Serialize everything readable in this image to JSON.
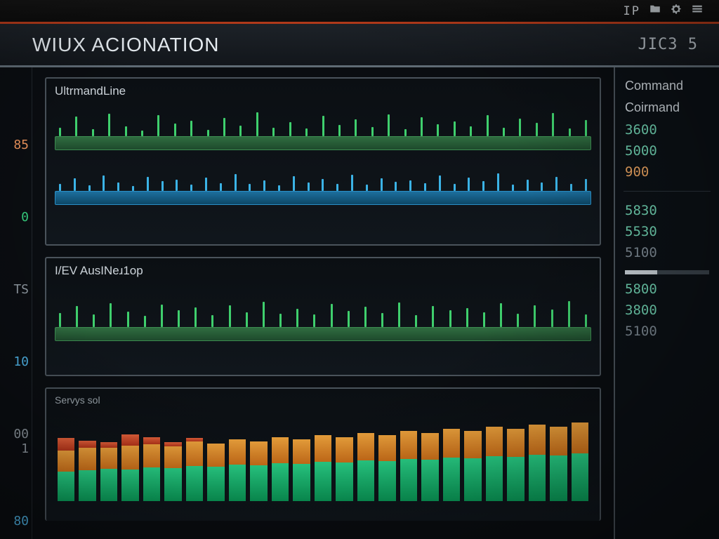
{
  "system": {
    "code": "IP",
    "icons": [
      "folder-icon",
      "gear-icon",
      "menu-icon"
    ]
  },
  "window": {
    "title_a": "WIUX",
    "title_b": "ACIONATION",
    "session": "JIC3 5"
  },
  "gutter": {
    "ticks": [
      "85",
      "0",
      "TS",
      "10",
      "00 1",
      "80"
    ]
  },
  "panels": {
    "p1": {
      "title": "UltrmandLine"
    },
    "p2": {
      "title": "I/EV AusINeɹ1op"
    },
    "p3": {
      "sub": "Servys sol"
    }
  },
  "sidebar": {
    "header1": "Command",
    "header2": "Coirmand",
    "values": [
      "3600",
      "5000",
      "900",
      "5830",
      "5530",
      "5100"
    ],
    "lower": [
      "5800",
      "3800",
      "5100"
    ]
  },
  "chart_data": [
    {
      "type": "bar",
      "title": "UltrmandLine",
      "series": [
        {
          "name": "green-ticks",
          "values": [
            12,
            28,
            10,
            32,
            14,
            8,
            30,
            18,
            22,
            9,
            26,
            15,
            34,
            12,
            20,
            11,
            29,
            16,
            24,
            13,
            31,
            10,
            27,
            17,
            21,
            14,
            30,
            12,
            25,
            19,
            33,
            11,
            23
          ]
        },
        {
          "name": "blue-ticks",
          "values": [
            10,
            18,
            8,
            22,
            12,
            7,
            20,
            14,
            16,
            9,
            19,
            11,
            24,
            10,
            15,
            8,
            21,
            12,
            17,
            10,
            23,
            9,
            18,
            13,
            15,
            11,
            22,
            10,
            19,
            14,
            25,
            9,
            16,
            12,
            20,
            10,
            17
          ]
        }
      ],
      "ylim": [
        0,
        40
      ]
    },
    {
      "type": "bar",
      "title": "I/EV AusINeɹ1op",
      "series": [
        {
          "name": "green-ticks",
          "values": [
            20,
            30,
            18,
            34,
            22,
            16,
            32,
            24,
            28,
            17,
            31,
            21,
            36,
            19,
            26,
            18,
            33,
            23,
            29,
            20,
            35,
            17,
            30,
            24,
            27,
            21,
            34,
            19,
            31,
            25,
            37,
            18
          ]
        }
      ],
      "ylim": [
        0,
        40
      ]
    },
    {
      "type": "bar",
      "title": "Servys sol",
      "xlabel": "",
      "ylabel": "",
      "series": [
        {
          "name": "green",
          "values": [
            42,
            44,
            46,
            45,
            48,
            47,
            50,
            49,
            52,
            51,
            54,
            53,
            56,
            55,
            58,
            57,
            60,
            59,
            62,
            61,
            64,
            63,
            66,
            65,
            68
          ]
        },
        {
          "name": "orange",
          "values": [
            30,
            32,
            30,
            34,
            33,
            31,
            35,
            33,
            36,
            34,
            37,
            35,
            38,
            36,
            39,
            37,
            40,
            38,
            41,
            39,
            42,
            40,
            43,
            41,
            44
          ]
        },
        {
          "name": "red",
          "values": [
            18,
            10,
            8,
            16,
            10,
            6,
            5,
            0,
            0,
            0,
            0,
            0,
            0,
            0,
            0,
            0,
            0,
            0,
            0,
            0,
            0,
            0,
            0,
            0,
            0
          ]
        }
      ],
      "stacked": true,
      "ylim": [
        0,
        130
      ]
    }
  ]
}
